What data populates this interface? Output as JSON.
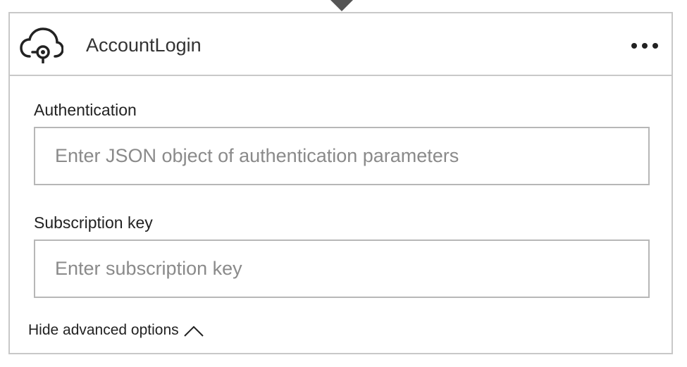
{
  "card": {
    "title": "AccountLogin",
    "icon": "cloud-connector-icon",
    "menu_icon": "more-options-icon"
  },
  "fields": [
    {
      "label": "Authentication",
      "value": "",
      "placeholder": "Enter JSON object of authentication parameters"
    },
    {
      "label": "Subscription key",
      "value": "",
      "placeholder": "Enter subscription key"
    }
  ],
  "advanced": {
    "label": "Hide advanced options",
    "icon": "chevron-up-icon"
  },
  "colors": {
    "border": "#c8c8c8",
    "input_border": "#b7b7b7",
    "text": "#222222",
    "placeholder": "#8a8a8a",
    "connector_arrow": "#555555"
  }
}
